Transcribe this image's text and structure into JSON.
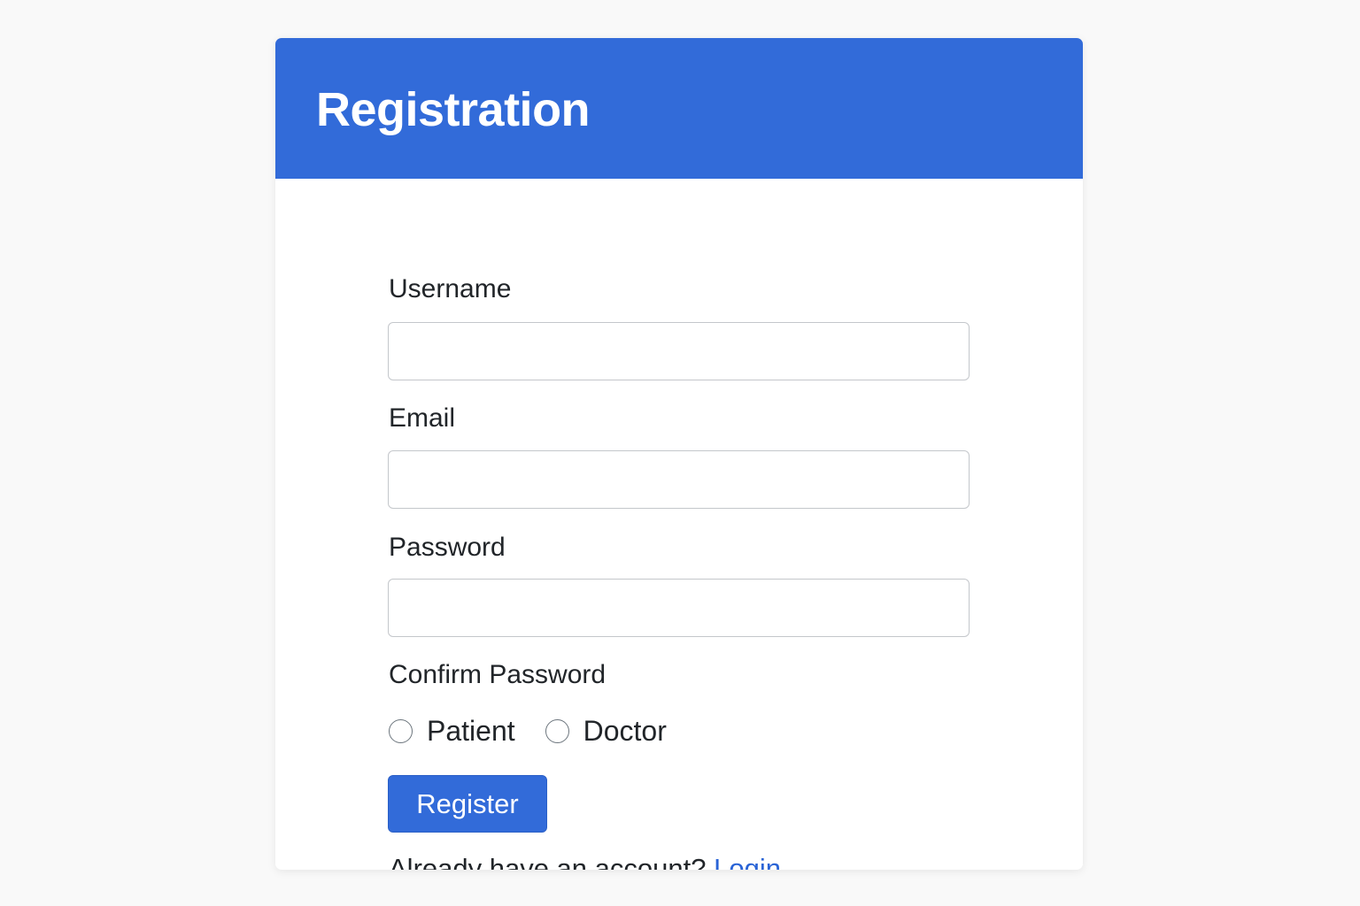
{
  "colors": {
    "page_background": "#f9f9f9",
    "header_background": "#326bd9",
    "primary_button": "#326bd9",
    "link": "#2a64d6",
    "text": "#212529"
  },
  "header": {
    "title": "Registration"
  },
  "form": {
    "username": {
      "label": "Username",
      "value": ""
    },
    "email": {
      "label": "Email",
      "value": ""
    },
    "password": {
      "label": "Password",
      "value": ""
    },
    "confirm_password": {
      "label": "Confirm Password"
    },
    "role": {
      "options": [
        {
          "label": "Patient",
          "selected": false
        },
        {
          "label": "Doctor",
          "selected": false
        }
      ]
    },
    "submit_label": "Register"
  },
  "footer": {
    "prompt": "Already have an account?",
    "link_label": "Login"
  }
}
